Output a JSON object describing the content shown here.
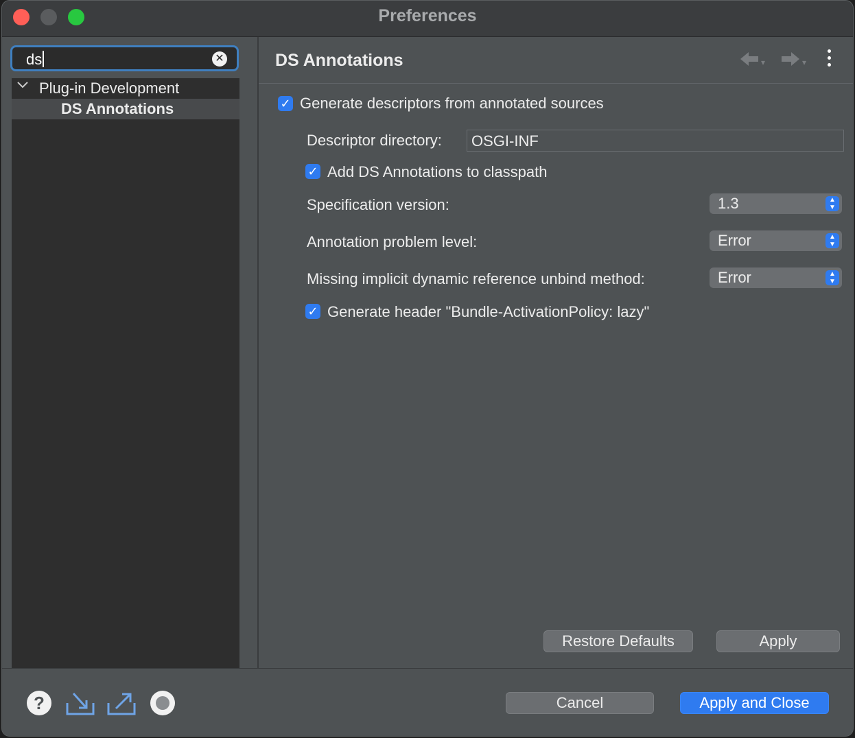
{
  "window": {
    "title": "Preferences"
  },
  "sidebar": {
    "search": {
      "value": "ds",
      "clear_icon": "clear-icon"
    },
    "tree": [
      {
        "label": "Plug-in Development",
        "expanded": true
      },
      {
        "label": "DS Annotations",
        "selected": true
      }
    ]
  },
  "page": {
    "title": "DS Annotations",
    "generate_descriptors": {
      "label": "Generate descriptors from annotated sources",
      "checked": true
    },
    "descriptor_directory": {
      "label": "Descriptor directory:",
      "value": "OSGI-INF"
    },
    "add_classpath": {
      "label": "Add DS Annotations to classpath",
      "checked": true
    },
    "spec_version": {
      "label": "Specification version:",
      "value": "1.3"
    },
    "problem_level": {
      "label": "Annotation problem level:",
      "value": "Error"
    },
    "missing_unbind": {
      "label": "Missing implicit dynamic reference unbind method:",
      "value": "Error"
    },
    "generate_header": {
      "label": "Generate header \"Bundle-ActivationPolicy: lazy\"",
      "checked": true
    },
    "restore_defaults": "Restore Defaults",
    "apply": "Apply"
  },
  "footer": {
    "cancel": "Cancel",
    "apply_close": "Apply and Close",
    "icons": [
      "help-icon",
      "import-icon",
      "export-icon",
      "record-icon"
    ]
  },
  "colors": {
    "accent": "#2f7bf0",
    "background": "#4e5254",
    "tree_bg": "#2e2e2e"
  }
}
